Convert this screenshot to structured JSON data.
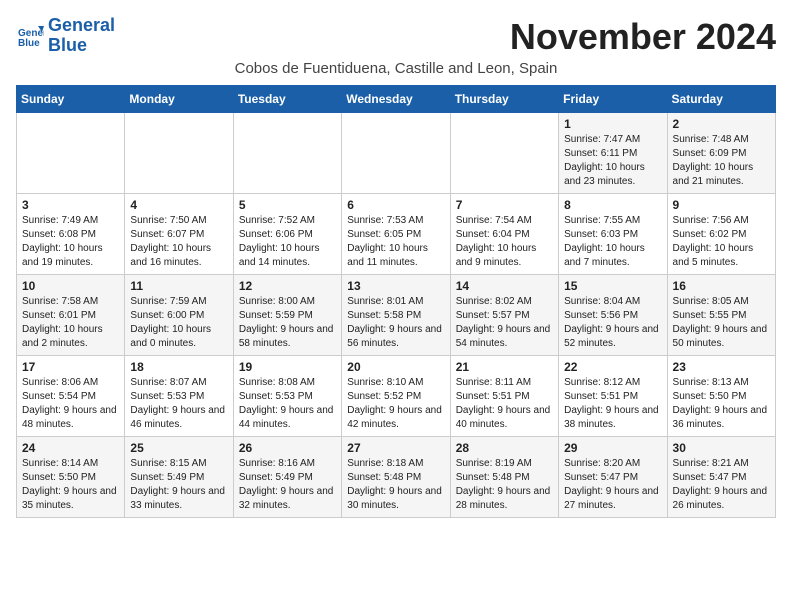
{
  "header": {
    "logo_line1": "General",
    "logo_line2": "Blue",
    "month_title": "November 2024",
    "location": "Cobos de Fuentiduena, Castille and Leon, Spain"
  },
  "weekdays": [
    "Sunday",
    "Monday",
    "Tuesday",
    "Wednesday",
    "Thursday",
    "Friday",
    "Saturday"
  ],
  "weeks": [
    [
      {
        "day": "",
        "info": ""
      },
      {
        "day": "",
        "info": ""
      },
      {
        "day": "",
        "info": ""
      },
      {
        "day": "",
        "info": ""
      },
      {
        "day": "",
        "info": ""
      },
      {
        "day": "1",
        "info": "Sunrise: 7:47 AM\nSunset: 6:11 PM\nDaylight: 10 hours and 23 minutes."
      },
      {
        "day": "2",
        "info": "Sunrise: 7:48 AM\nSunset: 6:09 PM\nDaylight: 10 hours and 21 minutes."
      }
    ],
    [
      {
        "day": "3",
        "info": "Sunrise: 7:49 AM\nSunset: 6:08 PM\nDaylight: 10 hours and 19 minutes."
      },
      {
        "day": "4",
        "info": "Sunrise: 7:50 AM\nSunset: 6:07 PM\nDaylight: 10 hours and 16 minutes."
      },
      {
        "day": "5",
        "info": "Sunrise: 7:52 AM\nSunset: 6:06 PM\nDaylight: 10 hours and 14 minutes."
      },
      {
        "day": "6",
        "info": "Sunrise: 7:53 AM\nSunset: 6:05 PM\nDaylight: 10 hours and 11 minutes."
      },
      {
        "day": "7",
        "info": "Sunrise: 7:54 AM\nSunset: 6:04 PM\nDaylight: 10 hours and 9 minutes."
      },
      {
        "day": "8",
        "info": "Sunrise: 7:55 AM\nSunset: 6:03 PM\nDaylight: 10 hours and 7 minutes."
      },
      {
        "day": "9",
        "info": "Sunrise: 7:56 AM\nSunset: 6:02 PM\nDaylight: 10 hours and 5 minutes."
      }
    ],
    [
      {
        "day": "10",
        "info": "Sunrise: 7:58 AM\nSunset: 6:01 PM\nDaylight: 10 hours and 2 minutes."
      },
      {
        "day": "11",
        "info": "Sunrise: 7:59 AM\nSunset: 6:00 PM\nDaylight: 10 hours and 0 minutes."
      },
      {
        "day": "12",
        "info": "Sunrise: 8:00 AM\nSunset: 5:59 PM\nDaylight: 9 hours and 58 minutes."
      },
      {
        "day": "13",
        "info": "Sunrise: 8:01 AM\nSunset: 5:58 PM\nDaylight: 9 hours and 56 minutes."
      },
      {
        "day": "14",
        "info": "Sunrise: 8:02 AM\nSunset: 5:57 PM\nDaylight: 9 hours and 54 minutes."
      },
      {
        "day": "15",
        "info": "Sunrise: 8:04 AM\nSunset: 5:56 PM\nDaylight: 9 hours and 52 minutes."
      },
      {
        "day": "16",
        "info": "Sunrise: 8:05 AM\nSunset: 5:55 PM\nDaylight: 9 hours and 50 minutes."
      }
    ],
    [
      {
        "day": "17",
        "info": "Sunrise: 8:06 AM\nSunset: 5:54 PM\nDaylight: 9 hours and 48 minutes."
      },
      {
        "day": "18",
        "info": "Sunrise: 8:07 AM\nSunset: 5:53 PM\nDaylight: 9 hours and 46 minutes."
      },
      {
        "day": "19",
        "info": "Sunrise: 8:08 AM\nSunset: 5:53 PM\nDaylight: 9 hours and 44 minutes."
      },
      {
        "day": "20",
        "info": "Sunrise: 8:10 AM\nSunset: 5:52 PM\nDaylight: 9 hours and 42 minutes."
      },
      {
        "day": "21",
        "info": "Sunrise: 8:11 AM\nSunset: 5:51 PM\nDaylight: 9 hours and 40 minutes."
      },
      {
        "day": "22",
        "info": "Sunrise: 8:12 AM\nSunset: 5:51 PM\nDaylight: 9 hours and 38 minutes."
      },
      {
        "day": "23",
        "info": "Sunrise: 8:13 AM\nSunset: 5:50 PM\nDaylight: 9 hours and 36 minutes."
      }
    ],
    [
      {
        "day": "24",
        "info": "Sunrise: 8:14 AM\nSunset: 5:50 PM\nDaylight: 9 hours and 35 minutes."
      },
      {
        "day": "25",
        "info": "Sunrise: 8:15 AM\nSunset: 5:49 PM\nDaylight: 9 hours and 33 minutes."
      },
      {
        "day": "26",
        "info": "Sunrise: 8:16 AM\nSunset: 5:49 PM\nDaylight: 9 hours and 32 minutes."
      },
      {
        "day": "27",
        "info": "Sunrise: 8:18 AM\nSunset: 5:48 PM\nDaylight: 9 hours and 30 minutes."
      },
      {
        "day": "28",
        "info": "Sunrise: 8:19 AM\nSunset: 5:48 PM\nDaylight: 9 hours and 28 minutes."
      },
      {
        "day": "29",
        "info": "Sunrise: 8:20 AM\nSunset: 5:47 PM\nDaylight: 9 hours and 27 minutes."
      },
      {
        "day": "30",
        "info": "Sunrise: 8:21 AM\nSunset: 5:47 PM\nDaylight: 9 hours and 26 minutes."
      }
    ]
  ]
}
